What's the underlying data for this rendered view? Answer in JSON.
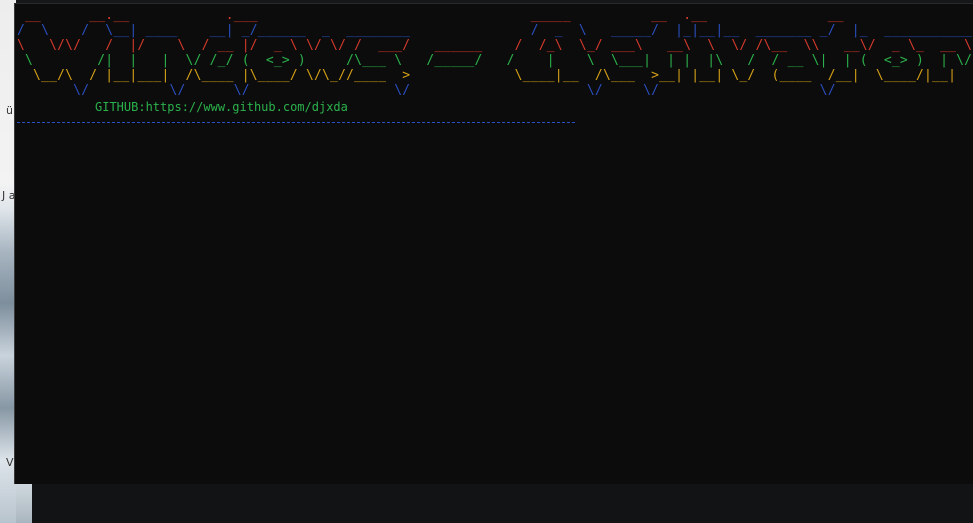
{
  "terminal": {
    "ascii_banner": [
      {
        "text": " __      __.__            .___                                  _____          __  .__               __                ",
        "color": "#d43a2c"
      },
      {
        "text": "/  \\    /  \\__| ____    __| _/______  _  ________               /  _  \\   _____/  |_|__|__  _______ _/  |_  ___________ ",
        "color": "#2a4fbf"
      },
      {
        "text": "\\   \\/\\/   /  |/    \\  / __ |/  _ \\ \\/ \\/ /  ___/   ______    /  /_\\  \\_/ ___\\   __\\  \\  \\/ /\\__  \\\\   __\\/  _ \\_  __ \\",
        "color": "#d43a2c"
      },
      {
        "text": " \\        /|  |   |  \\/ /_/ (  <_> )     /\\___ \\   /_____/   /    |    \\  \\___|  | |  |\\   /  / __ \\|  | (  <_> )  | \\/",
        "color": "#2bb24c"
      },
      {
        "text": "  \\__/\\  / |__|___|  /\\____ |\\____/ \\/\\_//____  >             \\____|__  /\\___  >__| |__| \\_/  (____  /__|  \\____/|__|   ",
        "color": "#d4a017"
      },
      {
        "text": "       \\/          \\/      \\/                  \\/                      \\/     \\/                    \\/                    ",
        "color": "#2a4fbf"
      }
    ],
    "github_line": "GITHUB:https://www.github.com/djxda"
  },
  "colors": {
    "terminal_bg": "#0c0c0c",
    "red": "#d43a2c",
    "blue": "#2a4fbf",
    "green": "#2bb24c",
    "yellow": "#d4a017"
  },
  "background_fragments": [
    "ü",
    "J a",
    "V"
  ]
}
